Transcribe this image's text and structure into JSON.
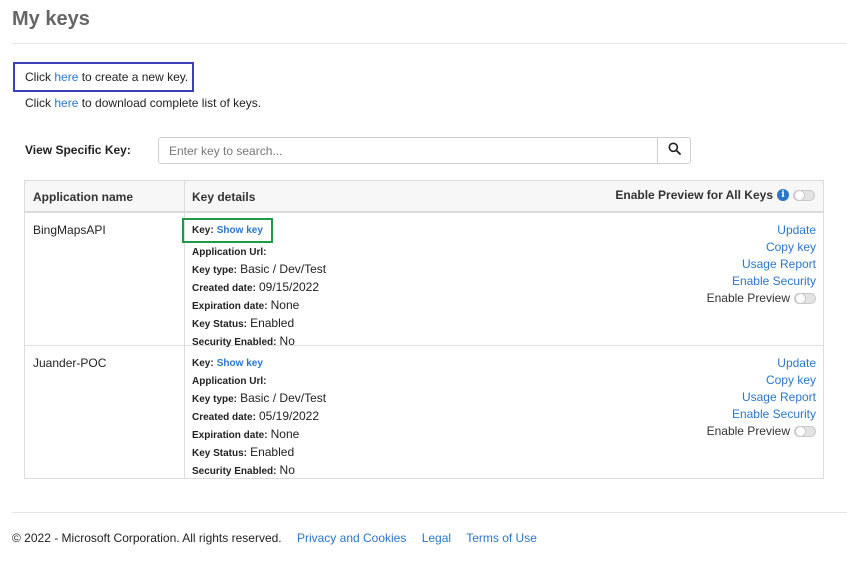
{
  "page": {
    "title": "My keys"
  },
  "instructions": {
    "create": {
      "prefix": "Click ",
      "link": "here",
      "suffix": " to create a new key."
    },
    "download": {
      "prefix": "Click ",
      "link": "here",
      "suffix": " to download complete list of keys."
    }
  },
  "search": {
    "label": "View Specific Key:",
    "placeholder": "Enter key to search...",
    "value": ""
  },
  "table": {
    "headers": {
      "application": "Application name",
      "details": "Key details",
      "preview_all": "Enable Preview for All Keys"
    },
    "rows": [
      {
        "app": "BingMapsAPI",
        "key_label": "Key:",
        "key_link": "Show key",
        "application_url_label": "Application Url:",
        "application_url": "",
        "key_type_label": "Key type:",
        "key_type": "Basic / Dev/Test",
        "created_label": "Created date:",
        "created": "09/15/2022",
        "expiration_label": "Expiration date:",
        "expiration": "None",
        "status_label": "Key Status:",
        "status": "Enabled",
        "security_label": "Security Enabled:",
        "security": "No",
        "actions": {
          "update": "Update",
          "copy": "Copy key",
          "usage": "Usage Report",
          "security": "Enable Security",
          "preview": "Enable Preview"
        }
      },
      {
        "app": "Juander-POC",
        "key_label": "Key:",
        "key_link": "Show key",
        "application_url_label": "Application Url:",
        "application_url": "",
        "key_type_label": "Key type:",
        "key_type": "Basic / Dev/Test",
        "created_label": "Created date:",
        "created": "05/19/2022",
        "expiration_label": "Expiration date:",
        "expiration": "None",
        "status_label": "Key Status:",
        "status": "Enabled",
        "security_label": "Security Enabled:",
        "security": "No",
        "actions": {
          "update": "Update",
          "copy": "Copy key",
          "usage": "Usage Report",
          "security": "Enable Security",
          "preview": "Enable Preview"
        }
      }
    ]
  },
  "footer": {
    "copyright": "© 2022 - Microsoft Corporation. All rights reserved.",
    "privacy": "Privacy and Cookies",
    "legal": "Legal",
    "terms": "Terms of Use"
  },
  "colors": {
    "link": "#2a77c9",
    "create_highlight": "#3b3fb8",
    "showkey_highlight": "#1f9a48"
  },
  "icons": {
    "search": "search-icon",
    "info": "info-icon"
  }
}
